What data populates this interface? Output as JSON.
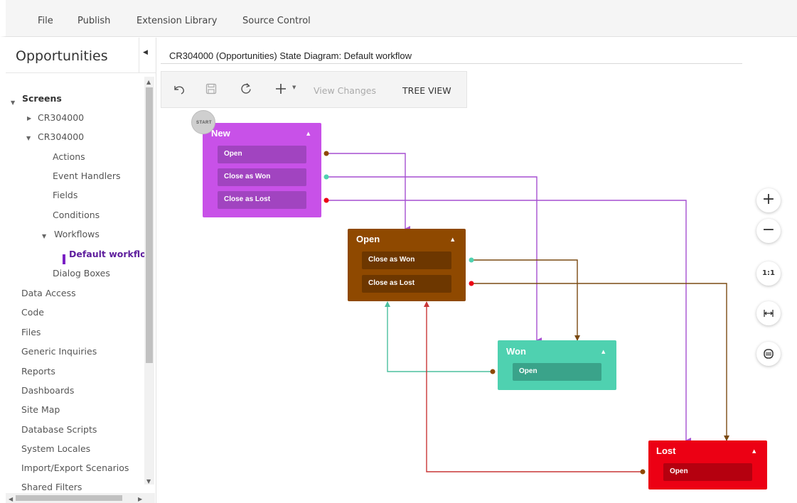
{
  "menubar": {
    "items": [
      "File",
      "Publish",
      "Extension Library",
      "Source Control"
    ]
  },
  "sidebar": {
    "title": "Opportunities",
    "collapse_icon": "triangle-left-icon",
    "tree": {
      "screens_label": "Screens",
      "screen1": "CR304000",
      "screen2": "CR304000",
      "children": [
        "Actions",
        "Event Handlers",
        "Fields",
        "Conditions"
      ],
      "workflows_label": "Workflows",
      "active_workflow": "Default workflo",
      "dialog_boxes": "Dialog Boxes",
      "sections": [
        "Data Access",
        "Code",
        "Files",
        "Generic Inquiries",
        "Reports",
        "Dashboards",
        "Site Map",
        "Database Scripts",
        "System Locales",
        "Import/Export Scenarios",
        "Shared Filters"
      ]
    }
  },
  "main": {
    "title": "CR304000 (Opportunities) State Diagram: Default workflow"
  },
  "toolbar": {
    "undo_icon": "undo-icon",
    "save_icon": "save-icon",
    "refresh_icon": "refresh-icon",
    "add_icon": "plus-icon",
    "view_changes": "View Changes",
    "tree_view": "TREE VIEW"
  },
  "diagram": {
    "start_label": "START",
    "states": {
      "new": {
        "title": "New",
        "color": "#c851e8",
        "action_color": "#a144c0",
        "actions": [
          "Open",
          "Close as Won",
          "Close as Lost"
        ]
      },
      "open": {
        "title": "Open",
        "color": "#8f4900",
        "action_color": "#6d3700",
        "actions": [
          "Close as Won",
          "Close as Lost"
        ]
      },
      "won": {
        "title": "Won",
        "color": "#4fd1b0",
        "action_color": "#3aa38a",
        "actions": [
          "Open"
        ]
      },
      "lost": {
        "title": "Lost",
        "color": "#ec0014",
        "action_color": "#b5000f",
        "actions": [
          "Open"
        ]
      }
    },
    "edge_colors": {
      "purple": "#a64fd1",
      "brown": "#7a4a12",
      "teal": "#4bbf9e",
      "red": "#c93636"
    }
  },
  "zoom": {
    "zoom_in": "+",
    "zoom_out": "−",
    "reset": "1:1",
    "fit_width_icon": "fit-width-icon",
    "fit_icon": "fit-page-icon"
  }
}
